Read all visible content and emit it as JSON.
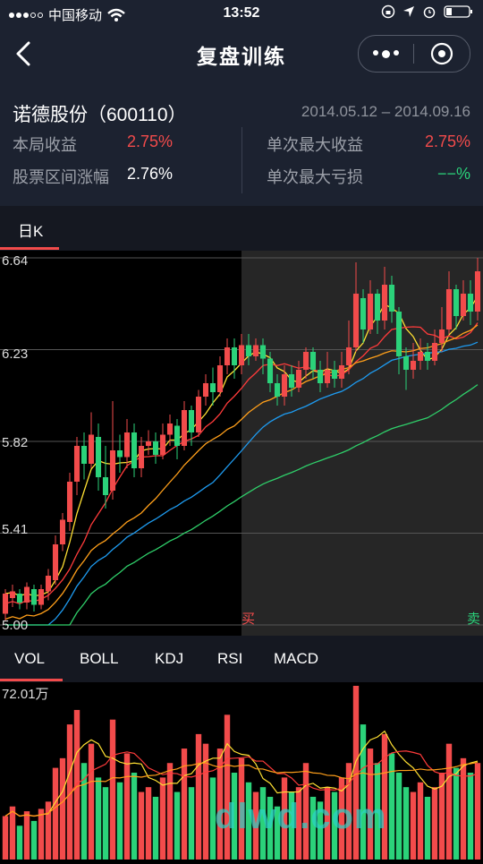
{
  "status_bar": {
    "carrier": "中国移动",
    "time": "13:52"
  },
  "nav": {
    "title": "复盘训练"
  },
  "stock": {
    "name": "诺德股份（600110）",
    "date_range": "2014.05.12 – 2014.09.16",
    "round_return_label": "本局收益",
    "round_return": "2.75%",
    "range_change_label": "股票区间涨幅",
    "range_change": "2.76%",
    "max_gain_label": "单次最大收益",
    "max_gain": "2.75%",
    "max_loss_label": "单次最大亏损",
    "max_loss": "−−%"
  },
  "kline_tab": "日K",
  "y_axis": [
    "6.64",
    "6.23",
    "5.82",
    "5.41",
    "5.00"
  ],
  "markers": {
    "buy": "买",
    "sell": "卖"
  },
  "indicator_tabs": [
    "VOL",
    "BOLL",
    "KDJ",
    "RSI",
    "MACD"
  ],
  "volume_max_label": "72.01万",
  "watermark": "dlwd.com",
  "colors": {
    "up": "#f24b4b",
    "down": "#2bd27a",
    "header_bg": "#1c2230",
    "ma5": "#ffe033",
    "ma10": "#ff3b3b",
    "ma20": "#ff9f1a",
    "ma30": "#1e9bf0",
    "ma60": "#2fcf6a"
  },
  "chart_data": {
    "type": "candlestick",
    "y_range": [
      5.0,
      6.64
    ],
    "candles": [
      [
        5.05,
        5.14,
        5.02,
        5.16
      ],
      [
        5.12,
        5.15,
        5.08,
        5.18
      ],
      [
        5.14,
        5.1,
        5.07,
        5.16
      ],
      [
        5.1,
        5.17,
        5.07,
        5.19
      ],
      [
        5.16,
        5.09,
        5.06,
        5.18
      ],
      [
        5.09,
        5.16,
        5.07,
        5.18
      ],
      [
        5.15,
        5.22,
        5.11,
        5.25
      ],
      [
        5.2,
        5.36,
        5.18,
        5.4
      ],
      [
        5.36,
        5.47,
        5.33,
        5.5
      ],
      [
        5.46,
        5.64,
        5.42,
        5.68
      ],
      [
        5.64,
        5.8,
        5.58,
        5.84
      ],
      [
        5.8,
        5.72,
        5.65,
        5.86
      ],
      [
        5.72,
        5.85,
        5.7,
        5.95
      ],
      [
        5.84,
        5.66,
        5.6,
        5.9
      ],
      [
        5.66,
        5.58,
        5.52,
        5.8
      ],
      [
        5.6,
        5.78,
        5.56,
        6.0
      ],
      [
        5.78,
        5.75,
        5.68,
        5.85
      ],
      [
        5.75,
        5.86,
        5.7,
        5.92
      ],
      [
        5.86,
        5.7,
        5.66,
        5.9
      ],
      [
        5.7,
        5.8,
        5.66,
        5.84
      ],
      [
        5.8,
        5.82,
        5.76,
        5.87
      ],
      [
        5.82,
        5.76,
        5.72,
        5.86
      ],
      [
        5.76,
        5.85,
        5.74,
        5.9
      ],
      [
        5.85,
        5.9,
        5.8,
        5.94
      ],
      [
        5.89,
        5.8,
        5.74,
        5.92
      ],
      [
        5.8,
        5.96,
        5.78,
        6.0
      ],
      [
        5.96,
        5.86,
        5.8,
        5.98
      ],
      [
        5.86,
        6.02,
        5.84,
        6.05
      ],
      [
        6.02,
        6.08,
        5.98,
        6.12
      ],
      [
        6.08,
        6.04,
        5.98,
        6.15
      ],
      [
        6.04,
        6.16,
        6.02,
        6.2
      ],
      [
        6.16,
        6.24,
        6.12,
        6.28
      ],
      [
        6.24,
        6.16,
        6.1,
        6.28
      ],
      [
        6.16,
        6.25,
        6.12,
        6.3
      ],
      [
        6.25,
        6.2,
        6.16,
        6.3
      ],
      [
        6.2,
        6.25,
        6.18,
        6.28
      ],
      [
        6.25,
        6.19,
        6.12,
        6.28
      ],
      [
        6.19,
        6.08,
        6.04,
        6.22
      ],
      [
        6.08,
        6.02,
        5.98,
        6.12
      ],
      [
        6.02,
        6.12,
        5.98,
        6.16
      ],
      [
        6.12,
        6.06,
        6.02,
        6.16
      ],
      [
        6.06,
        6.14,
        6.04,
        6.18
      ],
      [
        6.14,
        6.22,
        6.1,
        6.24
      ],
      [
        6.22,
        6.14,
        6.1,
        6.24
      ],
      [
        6.14,
        6.08,
        6.04,
        6.18
      ],
      [
        6.08,
        6.14,
        6.06,
        6.22
      ],
      [
        6.14,
        6.1,
        6.06,
        6.18
      ],
      [
        6.1,
        6.16,
        6.06,
        6.22
      ],
      [
        6.16,
        6.24,
        6.12,
        6.36
      ],
      [
        6.24,
        6.48,
        6.22,
        6.62
      ],
      [
        6.46,
        6.32,
        6.26,
        6.5
      ],
      [
        6.32,
        6.48,
        6.3,
        6.54
      ],
      [
        6.48,
        6.36,
        6.3,
        6.5
      ],
      [
        6.36,
        6.52,
        6.32,
        6.6
      ],
      [
        6.52,
        6.4,
        6.35,
        6.56
      ],
      [
        6.4,
        6.2,
        6.12,
        6.42
      ],
      [
        6.2,
        6.14,
        6.05,
        6.24
      ],
      [
        6.14,
        6.18,
        6.1,
        6.26
      ],
      [
        6.18,
        6.22,
        6.14,
        6.28
      ],
      [
        6.22,
        6.18,
        6.14,
        6.26
      ],
      [
        6.18,
        6.26,
        6.16,
        6.32
      ],
      [
        6.26,
        6.32,
        6.22,
        6.42
      ],
      [
        6.32,
        6.5,
        6.3,
        6.58
      ],
      [
        6.5,
        6.38,
        6.32,
        6.52
      ],
      [
        6.38,
        6.48,
        6.36,
        6.54
      ],
      [
        6.48,
        6.4,
        6.34,
        6.54
      ],
      [
        6.4,
        6.58,
        6.36,
        6.64
      ]
    ],
    "volumes": [
      18,
      22,
      14,
      20,
      16,
      21,
      24,
      38,
      42,
      56,
      62,
      40,
      48,
      34,
      30,
      58,
      32,
      44,
      36,
      28,
      30,
      26,
      34,
      40,
      28,
      46,
      30,
      52,
      48,
      34,
      46,
      60,
      36,
      42,
      32,
      28,
      30,
      26,
      22,
      34,
      28,
      30,
      40,
      26,
      24,
      30,
      28,
      34,
      40,
      72,
      56,
      46,
      40,
      52,
      44,
      36,
      30,
      28,
      32,
      26,
      30,
      36,
      48,
      38,
      42,
      36,
      40
    ]
  }
}
